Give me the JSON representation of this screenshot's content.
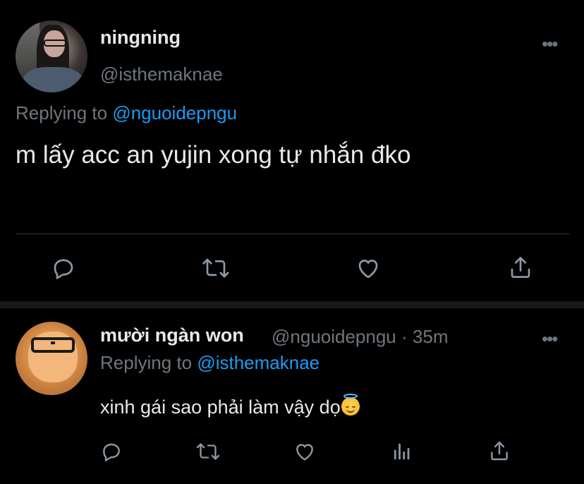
{
  "main_tweet": {
    "author_name": "ningning",
    "author_handle": "@isthemaknae",
    "replying_prefix": "Replying to ",
    "replying_to": "@nguoidepngu",
    "text": "m lấy acc an yujin xong tự nhắn đko",
    "more_label": "•••",
    "actions": [
      "reply-icon",
      "retweet-icon",
      "like-icon",
      "share-icon"
    ]
  },
  "reply_tweet": {
    "author_name": "mười ngàn won",
    "author_handle": "@nguoidepngu",
    "separator": "·",
    "timestamp": "35m",
    "replying_prefix": "Replying to ",
    "replying_to": "@isthemaknae",
    "text": "xinh gái sao phải làm vậy dọ",
    "emoji": "smiling-face-with-halo",
    "more_label": "•••",
    "actions": [
      "reply-icon",
      "retweet-icon",
      "like-icon",
      "analytics-icon",
      "share-icon"
    ]
  },
  "colors": {
    "background": "#000000",
    "text_primary": "#e7e9ea",
    "text_secondary": "#6e767d",
    "accent": "#1d9bf0",
    "icon": "#8b98a5",
    "divider": "#2f3336"
  }
}
